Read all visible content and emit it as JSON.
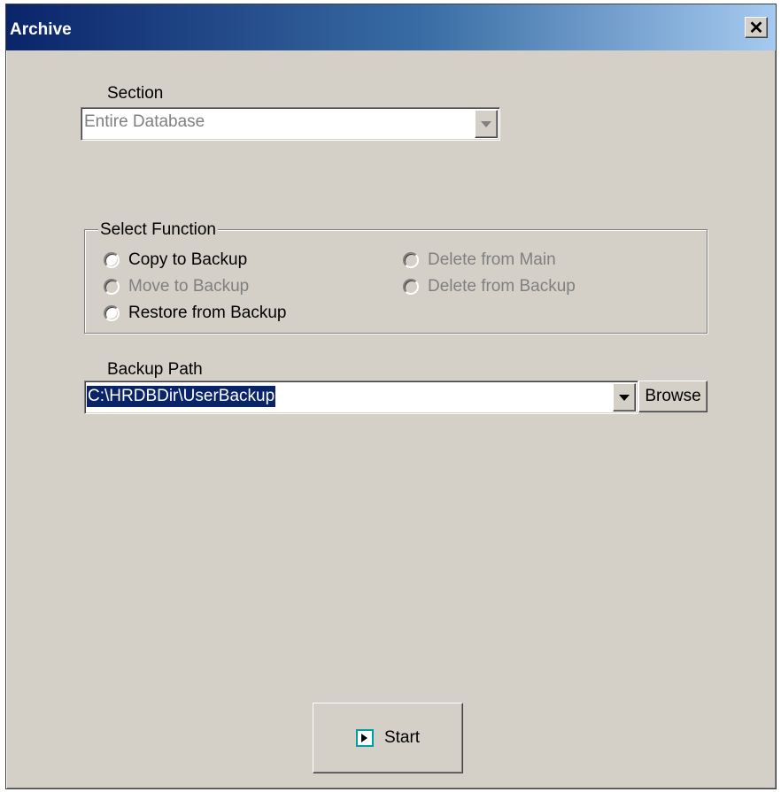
{
  "window": {
    "title": "Archive",
    "close_symbol": "✕"
  },
  "section": {
    "label": "Section",
    "value": "Entire Database",
    "enabled": false
  },
  "select_function": {
    "legend": "Select Function",
    "options": [
      {
        "label": "Copy to Backup",
        "enabled": true,
        "selected": false
      },
      {
        "label": "Move to Backup",
        "enabled": false,
        "selected": false
      },
      {
        "label": "Restore from Backup",
        "enabled": true,
        "selected": false
      },
      {
        "label": "Delete from Main",
        "enabled": false,
        "selected": false
      },
      {
        "label": "Delete from Backup",
        "enabled": false,
        "selected": false
      }
    ]
  },
  "backup_path": {
    "label": "Backup Path",
    "value": "C:\\HRDBDir\\UserBackup",
    "browse_label": "Browse"
  },
  "start": {
    "label": "Start",
    "icon": "play-icon"
  },
  "colors": {
    "titlebar_start": "#0a246a",
    "titlebar_end": "#a6caf0",
    "face": "#d4d0c8",
    "highlight": "#0a246a"
  }
}
